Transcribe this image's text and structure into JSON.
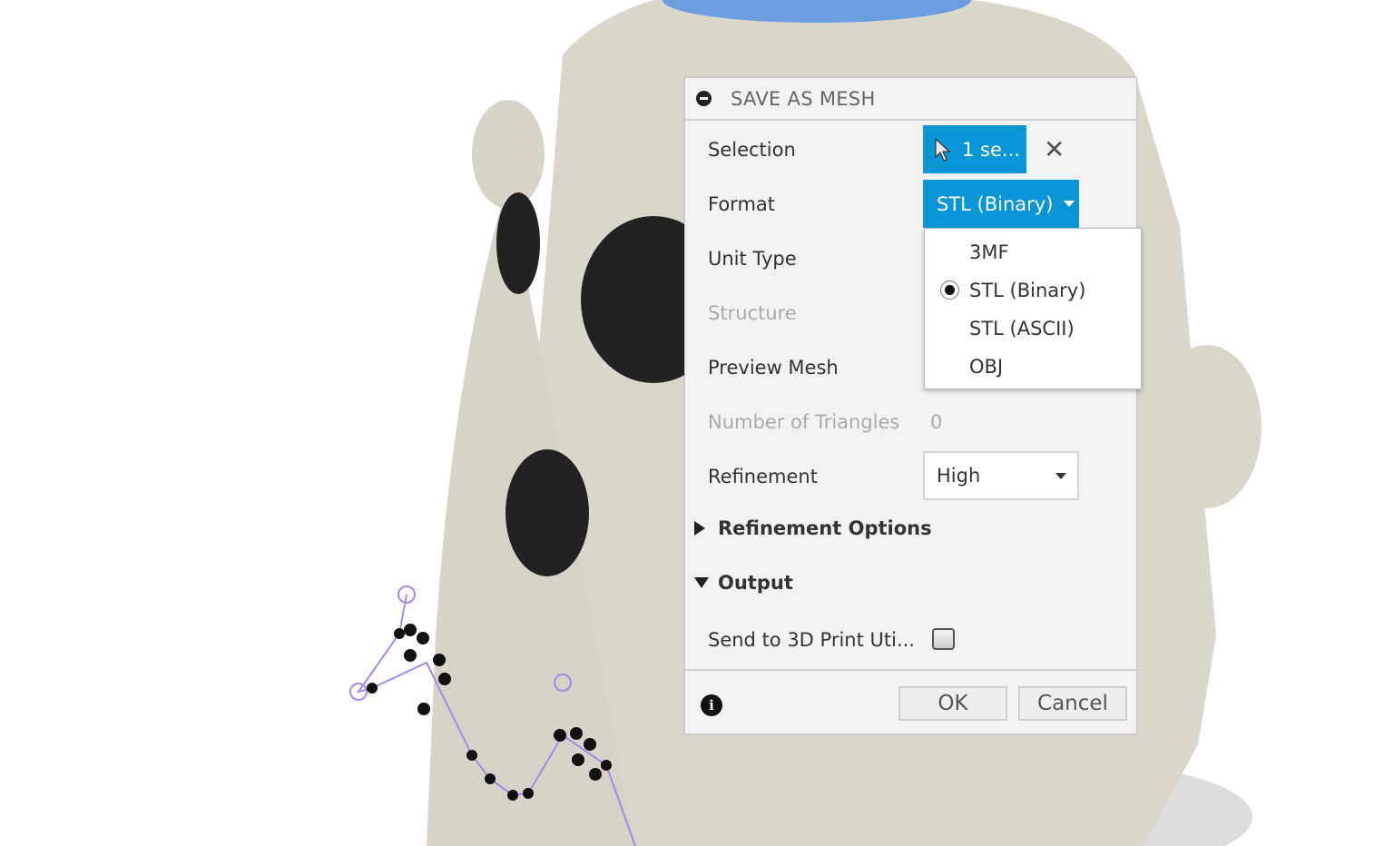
{
  "dialog": {
    "title": "SAVE AS MESH",
    "selection": {
      "label": "Selection",
      "value": "1 se..."
    },
    "format": {
      "label": "Format",
      "value": "STL (Binary)",
      "options": [
        "3MF",
        "STL (Binary)",
        "STL (ASCII)",
        "OBJ"
      ],
      "selected": "STL (Binary)"
    },
    "unit_type": {
      "label": "Unit Type"
    },
    "structure": {
      "label": "Structure"
    },
    "preview_mesh": {
      "label": "Preview Mesh"
    },
    "triangles": {
      "label": "Number of Triangles",
      "value": "0"
    },
    "refinement": {
      "label": "Refinement",
      "value": "High"
    },
    "refinement_options": {
      "label": "Refinement Options",
      "expanded": false
    },
    "output": {
      "label": "Output",
      "expanded": true
    },
    "send_to_print": {
      "label": "Send to 3D Print Uti...",
      "checked": false
    },
    "ok_label": "OK",
    "cancel_label": "Cancel"
  },
  "colors": {
    "accent": "#0996d6",
    "model": "#d9d6cc",
    "model_top": "#6a9ee0"
  }
}
